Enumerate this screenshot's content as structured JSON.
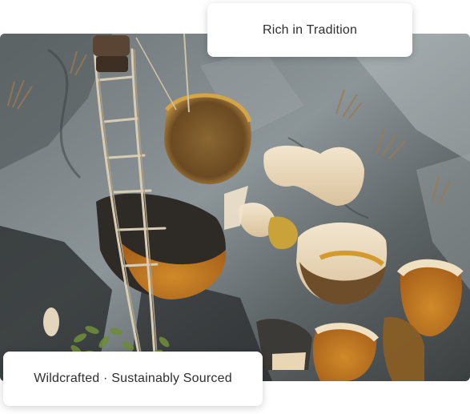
{
  "top_card": {
    "text": "Rich in Tradition"
  },
  "bottom_card": {
    "text": "Wildcrafted · Sustainably Sourced"
  },
  "photo": {
    "subject": "honeycombs-on-cliff-with-rope-ladder"
  }
}
